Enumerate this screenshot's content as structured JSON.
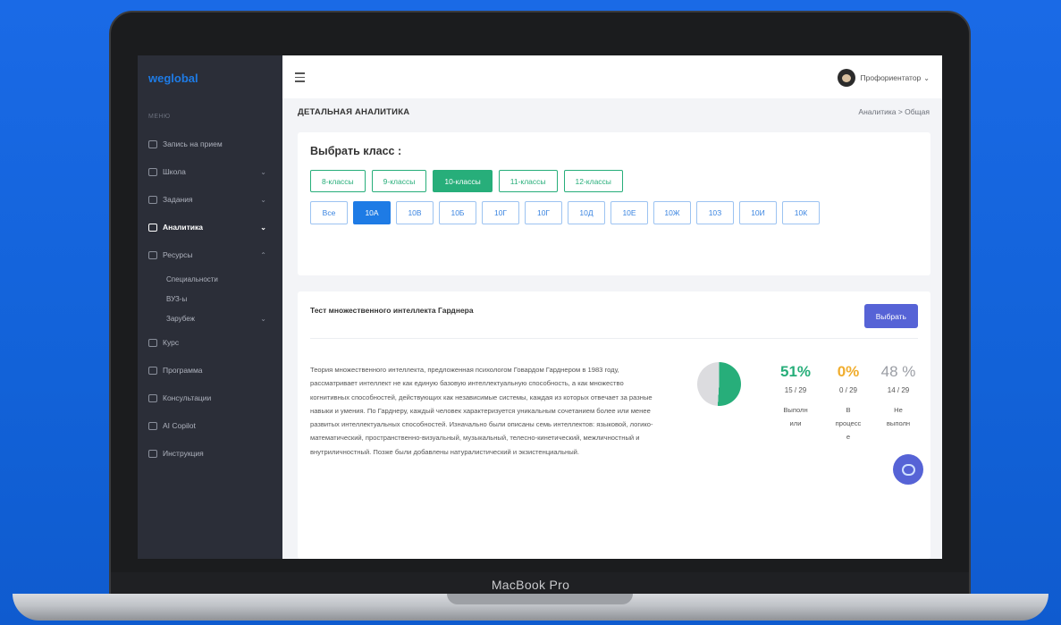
{
  "device": {
    "label": "MacBook Pro"
  },
  "app": {
    "logo": "weglobal",
    "menu_caption": "МЕНЮ",
    "sidebar": {
      "items": [
        {
          "label": "Запись на прием",
          "icon": "calendar-icon"
        },
        {
          "label": "Школа",
          "icon": "school-icon"
        },
        {
          "label": "Задания",
          "icon": "monitor-icon"
        },
        {
          "label": "Аналитика",
          "icon": "chart-icon"
        },
        {
          "label": "Ресурсы",
          "icon": "resources-icon"
        },
        {
          "label": "Курс",
          "icon": "course-icon"
        },
        {
          "label": "Программа",
          "icon": "program-icon"
        },
        {
          "label": "Консультации",
          "icon": "consult-icon"
        },
        {
          "label": "AI Copilot",
          "icon": "ai-icon"
        },
        {
          "label": "Инструкция",
          "icon": "instruction-icon"
        }
      ],
      "subitems": [
        "Специальности",
        "ВУЗ-ы",
        "Зарубеж"
      ]
    },
    "topbar": {
      "user_role": "Профориентатор"
    },
    "page": {
      "title": "ДЕТАЛЬНАЯ АНАЛИТИКА",
      "breadcrumb": "Аналитика  >  Общая"
    },
    "class_selector": {
      "label": "Выбрать класс :",
      "grades": [
        "8-классы",
        "9-классы",
        "10-классы",
        "11-классы",
        "12-классы"
      ],
      "active_grade": "10-классы",
      "classes": [
        "Все",
        "10А",
        "10В",
        "10Б",
        "10Г",
        "10Г",
        "10Д",
        "10Е",
        "10Ж",
        "10З",
        "10И",
        "10К"
      ],
      "active_class": "10А"
    },
    "test": {
      "title": "Тест множественного интеллекта Гарднера",
      "select_label": "Выбрать",
      "description": "Теория множественного интеллекта, предложенная психологом Говардом Гарднером в 1983 году, рассматривает интеллект не как единую базовую интеллектуальную способность, а как множество когнитивных способностей, действующих как независимые системы, каждая из которых отвечает за разные навыки и умения. По Гарднеру, каждый человек характеризуется уникальным сочетанием более или менее развитых интеллектуальных способностей. Изначально были описаны семь интеллектов: языковой, логико-математический, пространственно-визуальный, музыкальный, телесно-кинетический, межличностный и внутриличностный. Позже были добавлены натуралистический и экзистенциальный.",
      "stats": [
        {
          "percent": "51%",
          "fraction": 0.51,
          "count": "15 / 29",
          "label": "Выполн или",
          "color": "#27ae7a"
        },
        {
          "percent": "0%",
          "fraction": 0.0,
          "count": "0 / 29",
          "label": "В процесс е",
          "color": "#f0ad2e"
        },
        {
          "percent": "48 %",
          "fraction": 0.48,
          "count": "14 / 29",
          "label": "Не выполн",
          "color": "#9a9da4"
        }
      ]
    },
    "colors": {
      "accent_green": "#27ae7a",
      "accent_blue": "#1e7be5",
      "accent_indigo": "#5663d6",
      "sidebar_bg": "#2b2e38"
    }
  }
}
